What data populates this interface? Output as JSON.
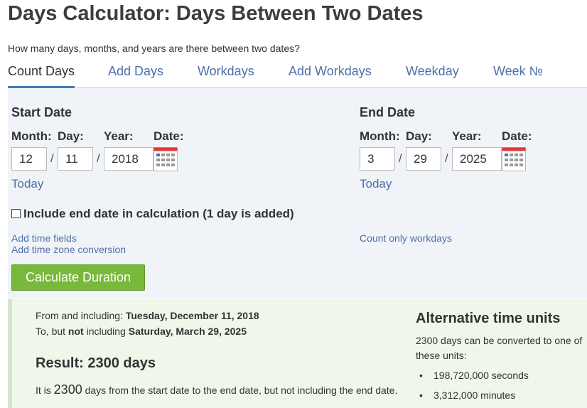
{
  "page": {
    "title": "Days Calculator: Days Between Two Dates",
    "subtitle": "How many days, months, and years are there between two dates?"
  },
  "tabs": [
    {
      "label": "Count Days",
      "active": true
    },
    {
      "label": "Add Days"
    },
    {
      "label": "Workdays"
    },
    {
      "label": "Add Workdays"
    },
    {
      "label": "Weekday"
    },
    {
      "label": "Week №"
    }
  ],
  "start": {
    "heading": "Start Date",
    "month_label": "Month:",
    "day_label": "Day:",
    "year_label": "Year:",
    "date_label": "Date:",
    "month": "12",
    "day": "11",
    "year": "2018",
    "today": "Today"
  },
  "end": {
    "heading": "End Date",
    "month_label": "Month:",
    "day_label": "Day:",
    "year_label": "Year:",
    "date_label": "Date:",
    "month": "3",
    "day": "29",
    "year": "2025",
    "today": "Today"
  },
  "separator": "/",
  "options": {
    "include_end_date": "Include end date in calculation (1 day is added)",
    "include_end_date_checked": false,
    "add_time_fields": "Add time fields",
    "add_time_zone": "Add time zone conversion",
    "count_workdays": "Count only workdays"
  },
  "button": {
    "label": "Calculate Duration"
  },
  "result": {
    "from_prefix": "From and including: ",
    "from_date": "Tuesday, December 11, 2018",
    "to_prefix": "To, but ",
    "to_not": "not",
    "to_mid": " including ",
    "to_date": "Saturday, March 29, 2025",
    "result_title": "Result: 2300 days",
    "it_is": "It is ",
    "days_count": "2300",
    "it_is_rest": " days from the start date to the end date, but not including the end date."
  },
  "alternative": {
    "title": "Alternative time units",
    "text": "2300 days can be converted to one of these units:",
    "units": [
      "198,720,000 seconds",
      "3,312,000 minutes"
    ]
  },
  "colors": {
    "link": "#4f6fa8",
    "button": "#78b83a",
    "tab_underline": "#3e7bbd",
    "panel_bg": "#f0f4f8",
    "result_bg": "#eef7ea",
    "calendar_red": "#e03a3a"
  }
}
